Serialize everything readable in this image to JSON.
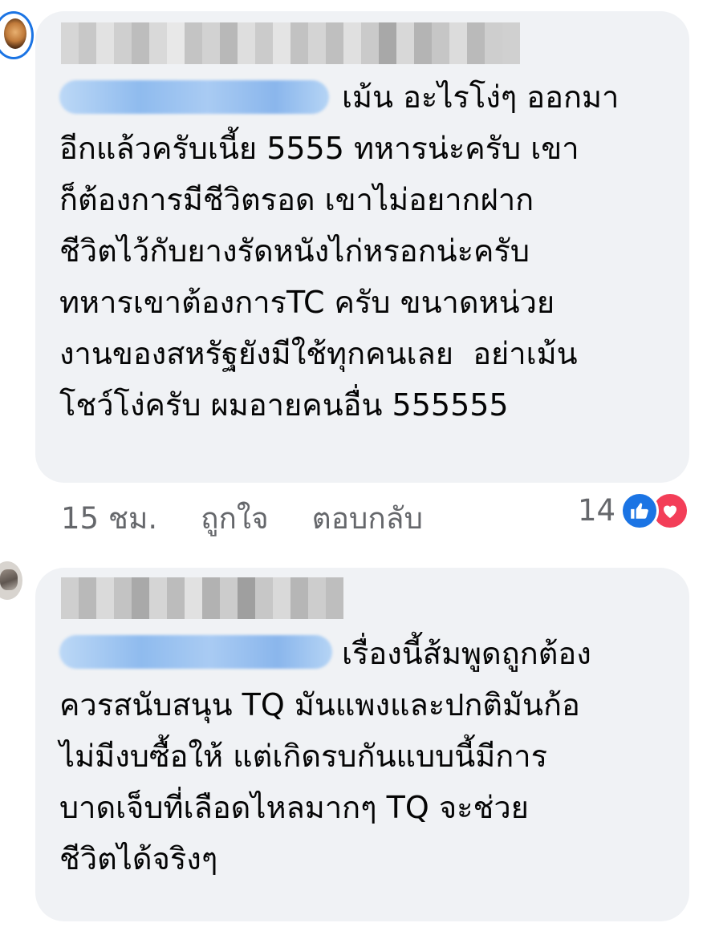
{
  "comments": [
    {
      "author_name": "",
      "tagged_name": "",
      "body": "เม้น อะไรโง่ๆ ออกมา\nอีกแล้วครับเนี้ย 5555 ทหารน่ะครับ เขา\nก็ต้องการมีชีวิตรอด เขาไม่อยากฝาก\nชีวิตไว้กับยางรัดหนังไก่หรอกน่ะครับ\nทหารเขาต้องการTC ครับ ขนาดหน่วย\nงานของสหรัฐยังมีใช้ทุกคนเลย  อย่าเม้น\nโชว์โง่ครับ ผมอายคนอื่น 555555",
      "time": "15 ชม.",
      "like_label": "ถูกใจ",
      "reply_label": "ตอบกลับ",
      "reaction_count": "14",
      "reaction_icons": [
        "like-icon",
        "love-icon"
      ]
    },
    {
      "author_name": "",
      "tagged_name": "",
      "body": "เรื่องนี้ส้มพูดถูกต้อง\nควรสนับสนุน TQ มันแพงและปกติมันก้อ\nไม่มีงบซื้อให้ แต่เกิดรบกันแบบนี้มีการ\nบาดเจ็บที่เลือดไหลมากๆ TQ จะช่วย\nชีวิตได้จริงๆ"
    }
  ],
  "colors": {
    "bubble": "#f0f2f5",
    "text": "#050505",
    "meta": "#65676b",
    "like": "#1b74e4",
    "love": "#f33e58"
  }
}
